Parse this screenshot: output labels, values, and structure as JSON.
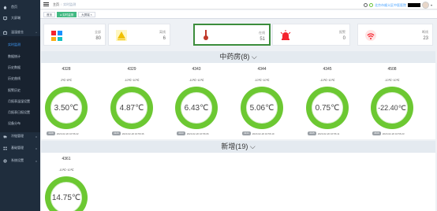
{
  "sidebar": {
    "items": [
      {
        "label": "首页",
        "icon": "home-icon"
      },
      {
        "label": "大屏端",
        "icon": "screen-icon"
      },
      {
        "label": "温湿度仓",
        "icon": "warehouse-icon"
      }
    ],
    "submenu": [
      {
        "label": "实时监测",
        "active": true
      },
      {
        "label": "数据统计"
      },
      {
        "label": "历史数据"
      },
      {
        "label": "历史曲线"
      },
      {
        "label": "报警历史"
      },
      {
        "label": "月报表温湿设置"
      },
      {
        "label": "月报表日报设置"
      },
      {
        "label": "设备分布"
      }
    ],
    "bottom": [
      {
        "label": "冷链管理",
        "icon": "truck-icon"
      },
      {
        "label": "基础管理",
        "icon": "grid-icon"
      },
      {
        "label": "系统设置",
        "icon": "gear-icon"
      }
    ]
  },
  "header": {
    "breadcrumb_home": "主页",
    "breadcrumb_current": "实时监测",
    "org": "北京市顺义区中医医院",
    "caret": "▾"
  },
  "tags": [
    {
      "label": "首页"
    },
    {
      "label": "● 实时监测",
      "active": true
    },
    {
      "label": "大屏端 ×"
    }
  ],
  "stats": [
    {
      "label": "全部",
      "count": "80",
      "icon": "grid-color-icon"
    },
    {
      "label": "离线",
      "count": "6",
      "icon": "offline-icon"
    },
    {
      "label": "在线",
      "count": "51",
      "icon": "thermometer-icon"
    },
    {
      "label": "报警",
      "count": "0",
      "icon": "alarm-icon"
    },
    {
      "label": "断线",
      "count": "23",
      "icon": "wifi-icon"
    }
  ],
  "sections": [
    {
      "title": "中药房(8)",
      "chevron": "⌵",
      "sensors": [
        {
          "name": "4328",
          "range": "2℃~8℃",
          "value": "3.50℃",
          "badge": "4328",
          "time": "2023-02-20 16:56:22"
        },
        {
          "name": "4329",
          "range": "-10℃~10℃",
          "value": "4.87℃",
          "badge": "4329",
          "time": "2023-02-20 16:56:36"
        },
        {
          "name": "4343",
          "range": "-10℃~10℃",
          "value": "6.43℃",
          "badge": "4343",
          "time": "2023-02-20 16:56:06"
        },
        {
          "name": "4344",
          "range": "-10℃~10℃",
          "value": "5.06℃",
          "badge": "4344",
          "time": "2023-02-20 16:56:19"
        },
        {
          "name": "4345",
          "range": "-10℃~10℃",
          "value": "0.75℃",
          "badge": "4345",
          "time": "2023-02-20 16:56:11"
        },
        {
          "name": "4508",
          "range": "-10℃~10℃",
          "value": "-22.40℃",
          "badge": "4508",
          "time": "2023-02-20 16:56:23"
        }
      ]
    },
    {
      "title": "新增(19)",
      "chevron": "⌵",
      "sensors": [
        {
          "name": "4361",
          "range": "-10℃~10℃",
          "value": "14.75℃"
        }
      ]
    }
  ]
}
